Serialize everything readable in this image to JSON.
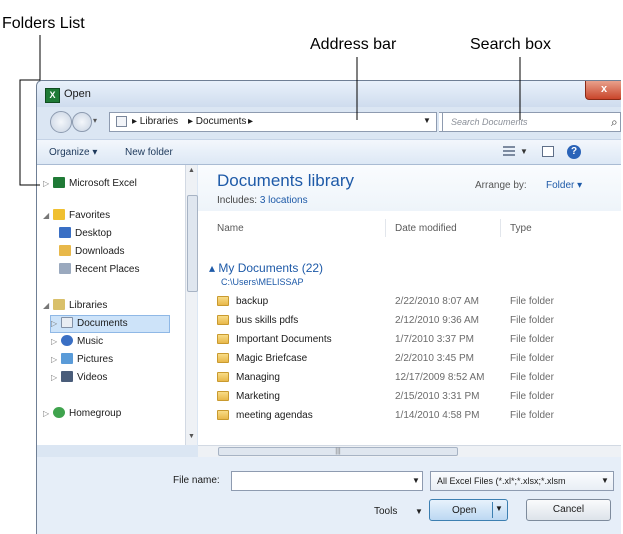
{
  "callouts": {
    "folders_list": "Folders List",
    "address_bar": "Address bar",
    "search_box": "Search box"
  },
  "window": {
    "title": "Open",
    "app_icon_letter": "X",
    "close_label": "x"
  },
  "address": {
    "segments": [
      "▸ Libraries",
      "▸ Documents",
      "▸"
    ],
    "refresh_icon": "refresh-icon"
  },
  "search": {
    "placeholder": "Search Documents"
  },
  "toolbar": {
    "organize": "Organize ▾",
    "new_folder": "New folder"
  },
  "nav": {
    "microsoft_excel": "Microsoft Excel",
    "favorites": "Favorites",
    "desktop": "Desktop",
    "downloads": "Downloads",
    "recent_places": "Recent Places",
    "libraries": "Libraries",
    "documents": "Documents",
    "music": "Music",
    "pictures": "Pictures",
    "videos": "Videos",
    "homegroup": "Homegroup"
  },
  "library": {
    "title": "Documents library",
    "includes_label": "Includes:",
    "includes_link": "3 locations",
    "arrange_label": "Arrange by:",
    "arrange_value": "Folder ▾"
  },
  "columns": {
    "name": "Name",
    "date": "Date modified",
    "type": "Type"
  },
  "group": {
    "title": "▴ My Documents (22)",
    "path": "C:\\Users\\MELISSAP"
  },
  "files": [
    {
      "name": "backup",
      "date": "2/22/2010 8:07 AM",
      "type": "File folder"
    },
    {
      "name": "bus skills pdfs",
      "date": "2/12/2010 9:36 AM",
      "type": "File folder"
    },
    {
      "name": "Important Documents",
      "date": "1/7/2010 3:37 PM",
      "type": "File folder"
    },
    {
      "name": "Magic Briefcase",
      "date": "2/2/2010 3:45 PM",
      "type": "File folder"
    },
    {
      "name": "Managing",
      "date": "12/17/2009 8:52 AM",
      "type": "File folder"
    },
    {
      "name": "Marketing",
      "date": "2/15/2010 3:31 PM",
      "type": "File folder"
    },
    {
      "name": "meeting agendas",
      "date": "1/14/2010 4:58 PM",
      "type": "File folder"
    }
  ],
  "bottom": {
    "file_name_label": "File name:",
    "file_name_value": "",
    "file_type": "All Excel Files (*.xl*;*.xlsx;*.xlsm",
    "tools": "Tools",
    "open": "Open",
    "cancel": "Cancel"
  },
  "colors": {
    "accent_blue": "#1e5aa8",
    "folder_yellow": "#e8b84a",
    "window_frame": "#dbe6f3",
    "close_red": "#c9452b"
  }
}
